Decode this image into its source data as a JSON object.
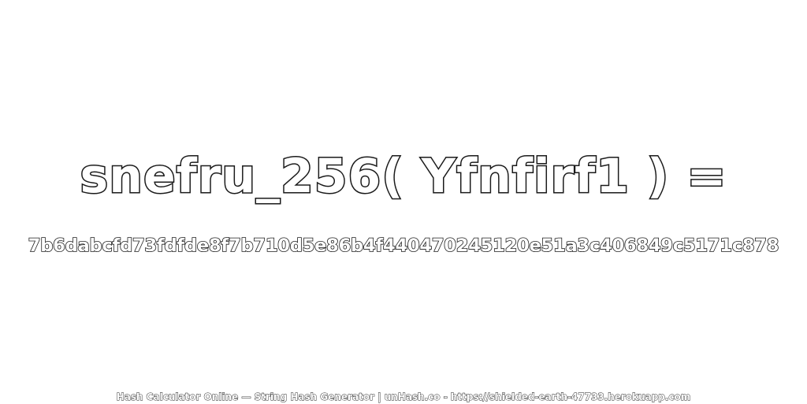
{
  "headline": "snefru_256( Yfnfirf1 ) =",
  "hash_value": "7b6dabcfd73fdfde8f7b710d5e86b4f440470245120e51a3c406849c5171c878",
  "footer": "Hash Calculator Online — String Hash Generator | unHash.co - https://shielded-earth-47733.herokuapp.com",
  "colors": {
    "background": "#ffffff",
    "text_fill": "#ffffff",
    "text_outline": "#1a1a1a"
  }
}
